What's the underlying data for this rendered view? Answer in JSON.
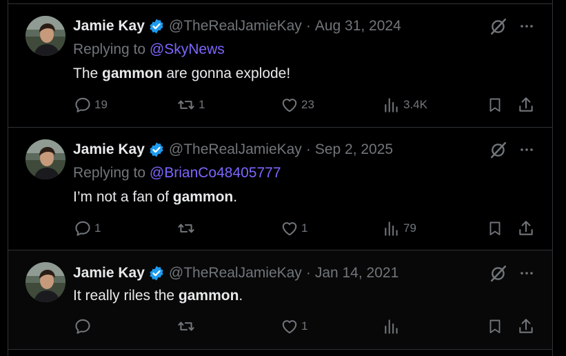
{
  "tweets": [
    {
      "author": "Jamie Kay",
      "handle": "@TheRealJamieKay",
      "date": "Aug 31, 2024",
      "replying_label": "Replying to",
      "replying_to": "@SkyNews",
      "text_before": "The ",
      "text_bold": "gammon",
      "text_after": " are gonna explode!",
      "replies": "19",
      "reposts": "1",
      "likes": "23",
      "views": "3.4K"
    },
    {
      "author": "Jamie Kay",
      "handle": "@TheRealJamieKay",
      "date": "Sep 2, 2025",
      "replying_label": "Replying to",
      "replying_to": "@BrianCo48405777",
      "text_before": "I’m not a fan of ",
      "text_bold": "gammon",
      "text_after": ".",
      "replies": "1",
      "reposts": "",
      "likes": "1",
      "views": "79"
    },
    {
      "author": "Jamie Kay",
      "handle": "@TheRealJamieKay",
      "date": "Jan 14, 2021",
      "text_before": "It really riles the ",
      "text_bold": "gammon",
      "text_after": ".",
      "replies": "",
      "reposts": "",
      "likes": "1",
      "views": ""
    }
  ],
  "separator": "·",
  "colors": {
    "mention": "#7b67ff",
    "muted": "#71767b",
    "text": "#e7e9ea",
    "verified": "#1d9bf0",
    "border": "#2f3336"
  },
  "icons": [
    "verified-badge-icon",
    "grok-icon",
    "more-icon",
    "reply-icon",
    "repost-icon",
    "like-icon",
    "views-icon",
    "bookmark-icon",
    "share-icon"
  ]
}
